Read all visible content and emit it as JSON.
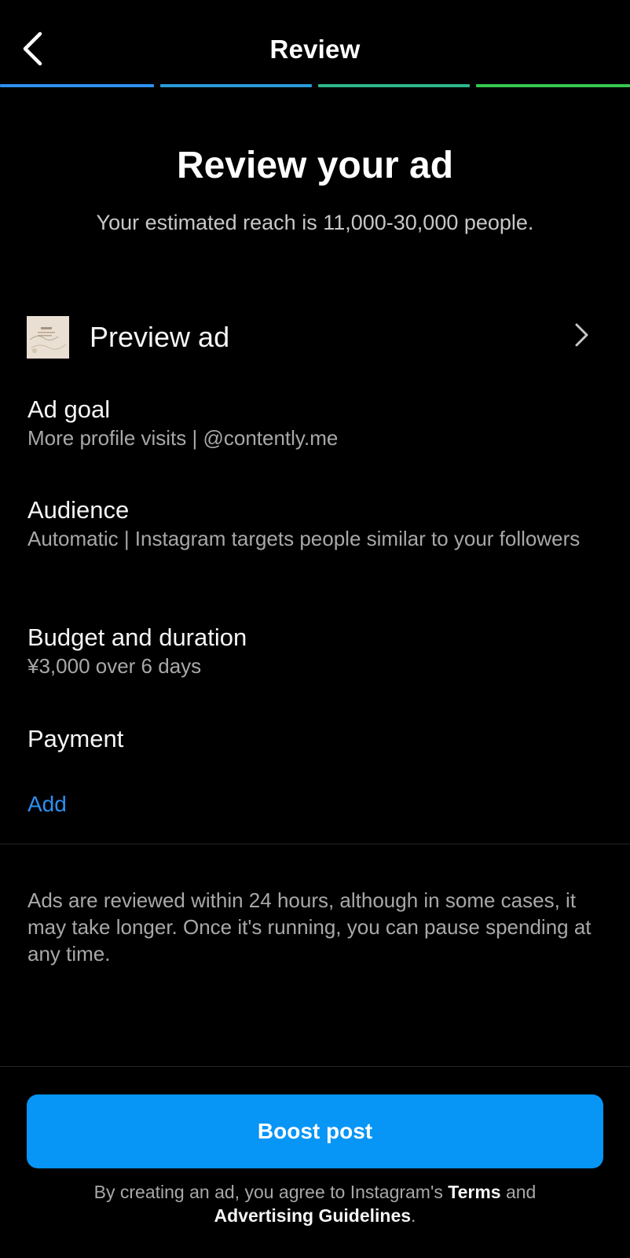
{
  "header": {
    "title": "Review",
    "progress_colors": [
      "#2d8ff0",
      "#2a9ad6",
      "#2cb78b",
      "#35c84f"
    ]
  },
  "hero": {
    "title": "Review your ad",
    "subtitle": "Your estimated reach is 11,000-30,000 people."
  },
  "preview": {
    "label": "Preview ad"
  },
  "sections": {
    "ad_goal": {
      "title": "Ad goal",
      "value": "More profile visits | @contently.me"
    },
    "audience": {
      "title": "Audience",
      "value": "Automatic | Instagram targets people similar to your followers"
    },
    "budget": {
      "title": "Budget and duration",
      "value": "¥3,000 over 6 days"
    },
    "payment": {
      "title": "Payment",
      "action": "Add"
    }
  },
  "info": "Ads are reviewed within 24 hours, although in some cases, it may take longer. Once it's running, you can pause spending at any time.",
  "boost_button": "Boost post",
  "legal": {
    "prefix": "By creating an ad, you agree to Instagram's",
    "terms": "Terms",
    "and": "and",
    "guidelines": "Advertising Guidelines",
    "suffix": "."
  },
  "colors": {
    "background": "#000000",
    "accent": "#0795f6",
    "link": "#2d8ff0",
    "secondary_text": "#a8a8a8"
  },
  "icons": {
    "back": "chevron-left-icon",
    "row": "chevron-right-icon"
  }
}
